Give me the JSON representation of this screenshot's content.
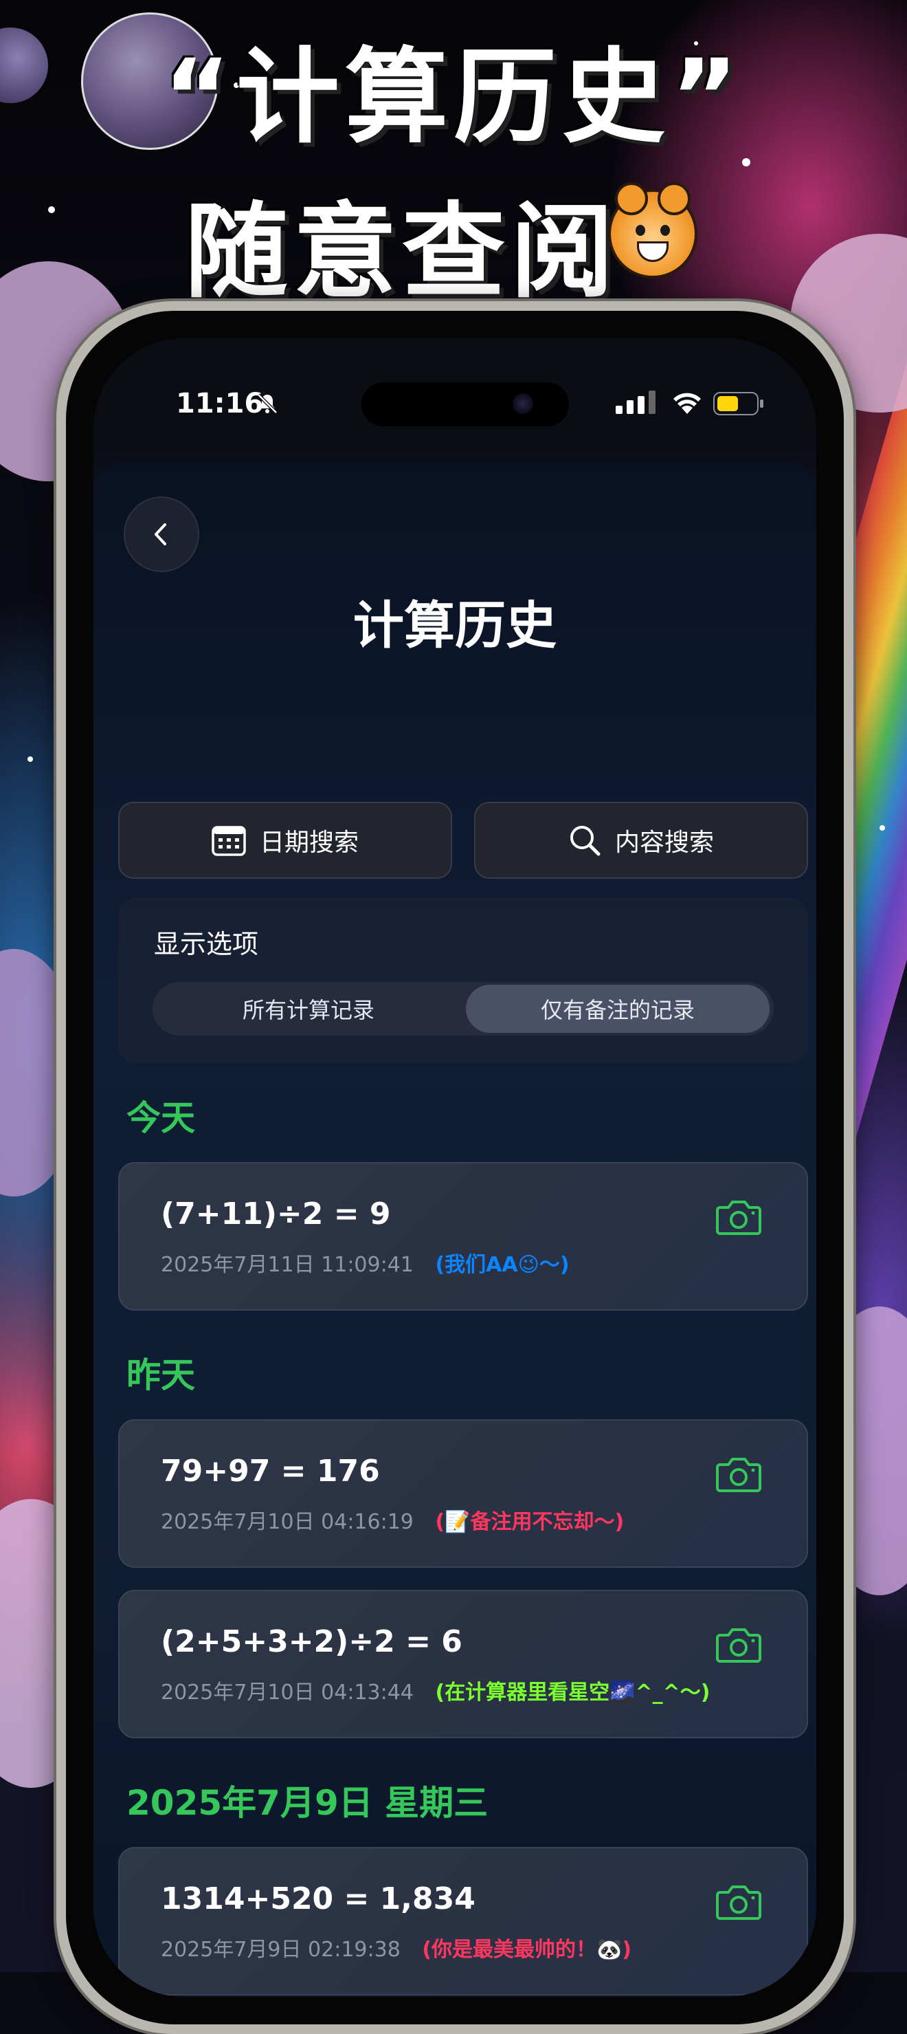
{
  "poster": {
    "title_line1": "“计算历史”",
    "title_line2": "随意查阅"
  },
  "status_bar": {
    "time": "11:16",
    "battery_color": "#ffd60a"
  },
  "header": {
    "title": "计算历史"
  },
  "search": {
    "date_label": "日期搜索",
    "content_label": "内容搜索"
  },
  "display_options": {
    "title": "显示选项",
    "options": [
      "所有计算记录",
      "仅有备注的记录"
    ],
    "selected": "仅有备注的记录"
  },
  "sections": [
    {
      "label": "今天",
      "records": [
        {
          "expression": "(7+11)÷2 = 9",
          "datetime": "2025年7月11日 11:09:41",
          "note": "(我们AA😉～)",
          "note_color": "#0a84ff"
        }
      ]
    },
    {
      "label": "昨天",
      "records": [
        {
          "expression": "79+97 = 176",
          "datetime": "2025年7月10日 04:16:19",
          "note": "(📝备注用不忘却～)",
          "note_color": "#ff375f"
        },
        {
          "expression": "(2+5+3+2)÷2 = 6",
          "datetime": "2025年7月10日 04:13:44",
          "note": "(在计算器里看星空🌌^_^～)",
          "note_color": "#7cff2e"
        }
      ]
    },
    {
      "label": "2025年7月9日 星期三",
      "records": [
        {
          "expression": "1314+520 = 1,834",
          "datetime": "2025年7月9日 02:19:38",
          "note": "(你是最美最帅的！🐼)",
          "note_color": "#ff375f"
        }
      ]
    }
  ],
  "colors": {
    "accent_green": "#35c759",
    "camera_icon": "#35c759"
  }
}
